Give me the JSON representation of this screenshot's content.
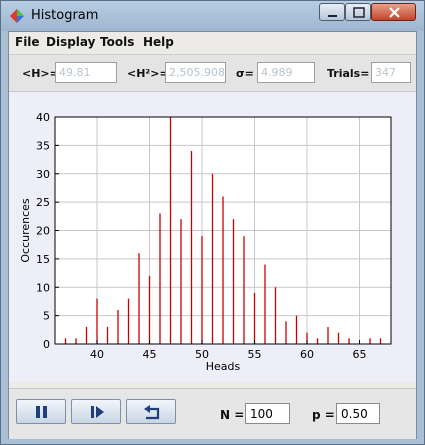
{
  "window": {
    "title": "Histogram"
  },
  "menu": {
    "items": [
      {
        "label": "File"
      },
      {
        "label": "Display"
      },
      {
        "label": "Tools"
      },
      {
        "label": "Help"
      }
    ]
  },
  "stats": {
    "mean_label": "<H>=",
    "mean_value": "49.81",
    "meansq_label": "<H²>=",
    "meansq_value": "2,505.908",
    "sigma_label": "σ=",
    "sigma_value": "4.989",
    "trials_label": "Trials=",
    "trials_value": "347"
  },
  "controls": {
    "pause_icon": "pause-icon",
    "step_icon": "step-icon",
    "reset_icon": "reset-icon",
    "n_label": "N =",
    "n_value": "100",
    "p_label": "p =",
    "p_value": "0.50"
  },
  "colors": {
    "bar": "#cc0000",
    "grid": "#c8c8c8",
    "plot_bg": "#ffffff",
    "panel_bg": "#eeeef8"
  },
  "chart_data": {
    "type": "bar",
    "xlabel": "Heads",
    "ylabel": "Occurences",
    "xlim": [
      36,
      68
    ],
    "ylim": [
      0,
      40
    ],
    "xticks": [
      40,
      45,
      50,
      55,
      60,
      65
    ],
    "yticks": [
      0,
      5,
      10,
      15,
      20,
      25,
      30,
      35,
      40
    ],
    "grid": true,
    "x": [
      37,
      38,
      39,
      40,
      41,
      42,
      43,
      44,
      45,
      46,
      47,
      48,
      49,
      50,
      51,
      52,
      53,
      54,
      55,
      56,
      57,
      58,
      59,
      60,
      61,
      62,
      63,
      64,
      65,
      66,
      67
    ],
    "values": [
      1,
      1,
      3,
      8,
      3,
      6,
      8,
      16,
      12,
      23,
      40,
      22,
      34,
      19,
      30,
      26,
      22,
      19,
      9,
      14,
      10,
      4,
      5,
      2,
      1,
      3,
      2,
      1,
      0,
      1,
      1
    ]
  }
}
